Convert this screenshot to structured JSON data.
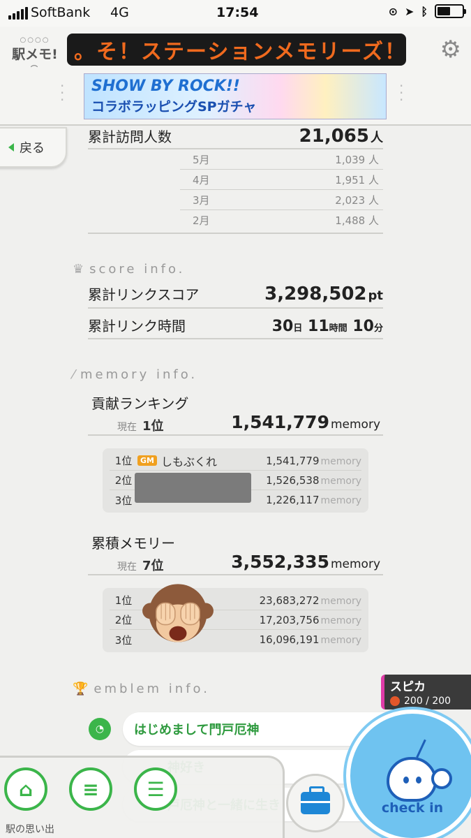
{
  "status_bar": {
    "carrier": "SoftBank",
    "network": "4G",
    "time": "17:54"
  },
  "header": {
    "logo_text": "駅メモ!",
    "ticker_text": "。そ！ステーションメモリーズ！の",
    "banner_title": "SHOW BY ROCK!!",
    "banner_subtitle": "コラボラッピングSPガチャ"
  },
  "back_button": {
    "label": "戻る"
  },
  "visitors": {
    "label": "累計訪問人数",
    "total": "21,065",
    "unit": "人",
    "months": [
      {
        "month": "5月",
        "value": "1,039 人"
      },
      {
        "month": "4月",
        "value": "1,951 人"
      },
      {
        "month": "3月",
        "value": "2,023 人"
      },
      {
        "month": "2月",
        "value": "1,488 人"
      }
    ]
  },
  "score_info": {
    "heading": "score info.",
    "link_score_label": "累計リンクスコア",
    "link_score_value": "3,298,502",
    "link_score_unit": "pt",
    "link_time_label": "累計リンク時間",
    "days": "30",
    "days_unit": "日",
    "hours": "11",
    "hours_unit": "時間",
    "minutes": "10",
    "minutes_unit": "分"
  },
  "memory_info": {
    "heading": "memory info.",
    "contribution": {
      "label": "貢献ランキング",
      "current_label": "現在",
      "current_rank": "1位",
      "value": "1,541,779",
      "unit": "memory",
      "ranking": [
        {
          "rank": "1位",
          "badge": "GM",
          "name": "しもぶくれ",
          "value": "1,541,779",
          "unit": "memory"
        },
        {
          "rank": "2位",
          "badge": "",
          "name": "",
          "value": "1,526,538",
          "unit": "memory"
        },
        {
          "rank": "3位",
          "badge": "",
          "name": "",
          "value": "1,226,117",
          "unit": "memory"
        }
      ]
    },
    "accumulated": {
      "label": "累積メモリー",
      "current_label": "現在",
      "current_rank": "7位",
      "value": "3,552,335",
      "unit": "memory",
      "ranking": [
        {
          "rank": "1位",
          "value": "23,683,272",
          "unit": "memory"
        },
        {
          "rank": "2位",
          "value": "17,203,756",
          "unit": "memory"
        },
        {
          "rank": "3位",
          "value": "16,096,191",
          "unit": "memory"
        }
      ]
    }
  },
  "emblem_info": {
    "heading": "emblem info.",
    "items": [
      "はじめまして門戸厄神",
      "神好き",
      "戸厄神と一緒に生き"
    ]
  },
  "character": {
    "name": "スピカ",
    "hp": "200 / 200"
  },
  "checkin_label": "check in",
  "bottom_nav": {
    "label": "駅の思い出"
  }
}
